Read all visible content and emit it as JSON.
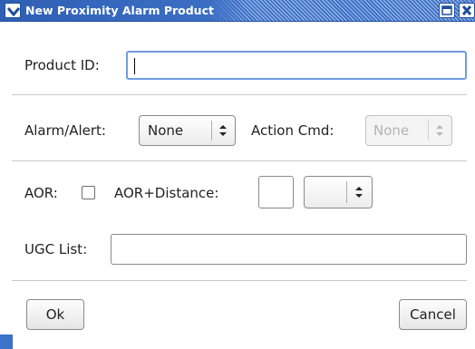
{
  "window": {
    "title": "New Proximity Alarm Product"
  },
  "colors": {
    "titlebar": "#3d72c9",
    "focus_border": "#6f9ce0"
  },
  "form": {
    "product_id_label": "Product ID:",
    "product_id_value": "",
    "alarm_alert_label": "Alarm/Alert:",
    "alarm_alert_value": "None",
    "action_cmd_label": "Action Cmd:",
    "action_cmd_value": "None",
    "aor_label": "AOR:",
    "aor_checked": false,
    "aor_distance_label": "AOR+Distance:",
    "aor_distance_value": "",
    "aor_distance_unit_value": "",
    "ugc_list_label": "UGC List:",
    "ugc_list_value": ""
  },
  "buttons": {
    "ok": "Ok",
    "cancel": "Cancel"
  }
}
